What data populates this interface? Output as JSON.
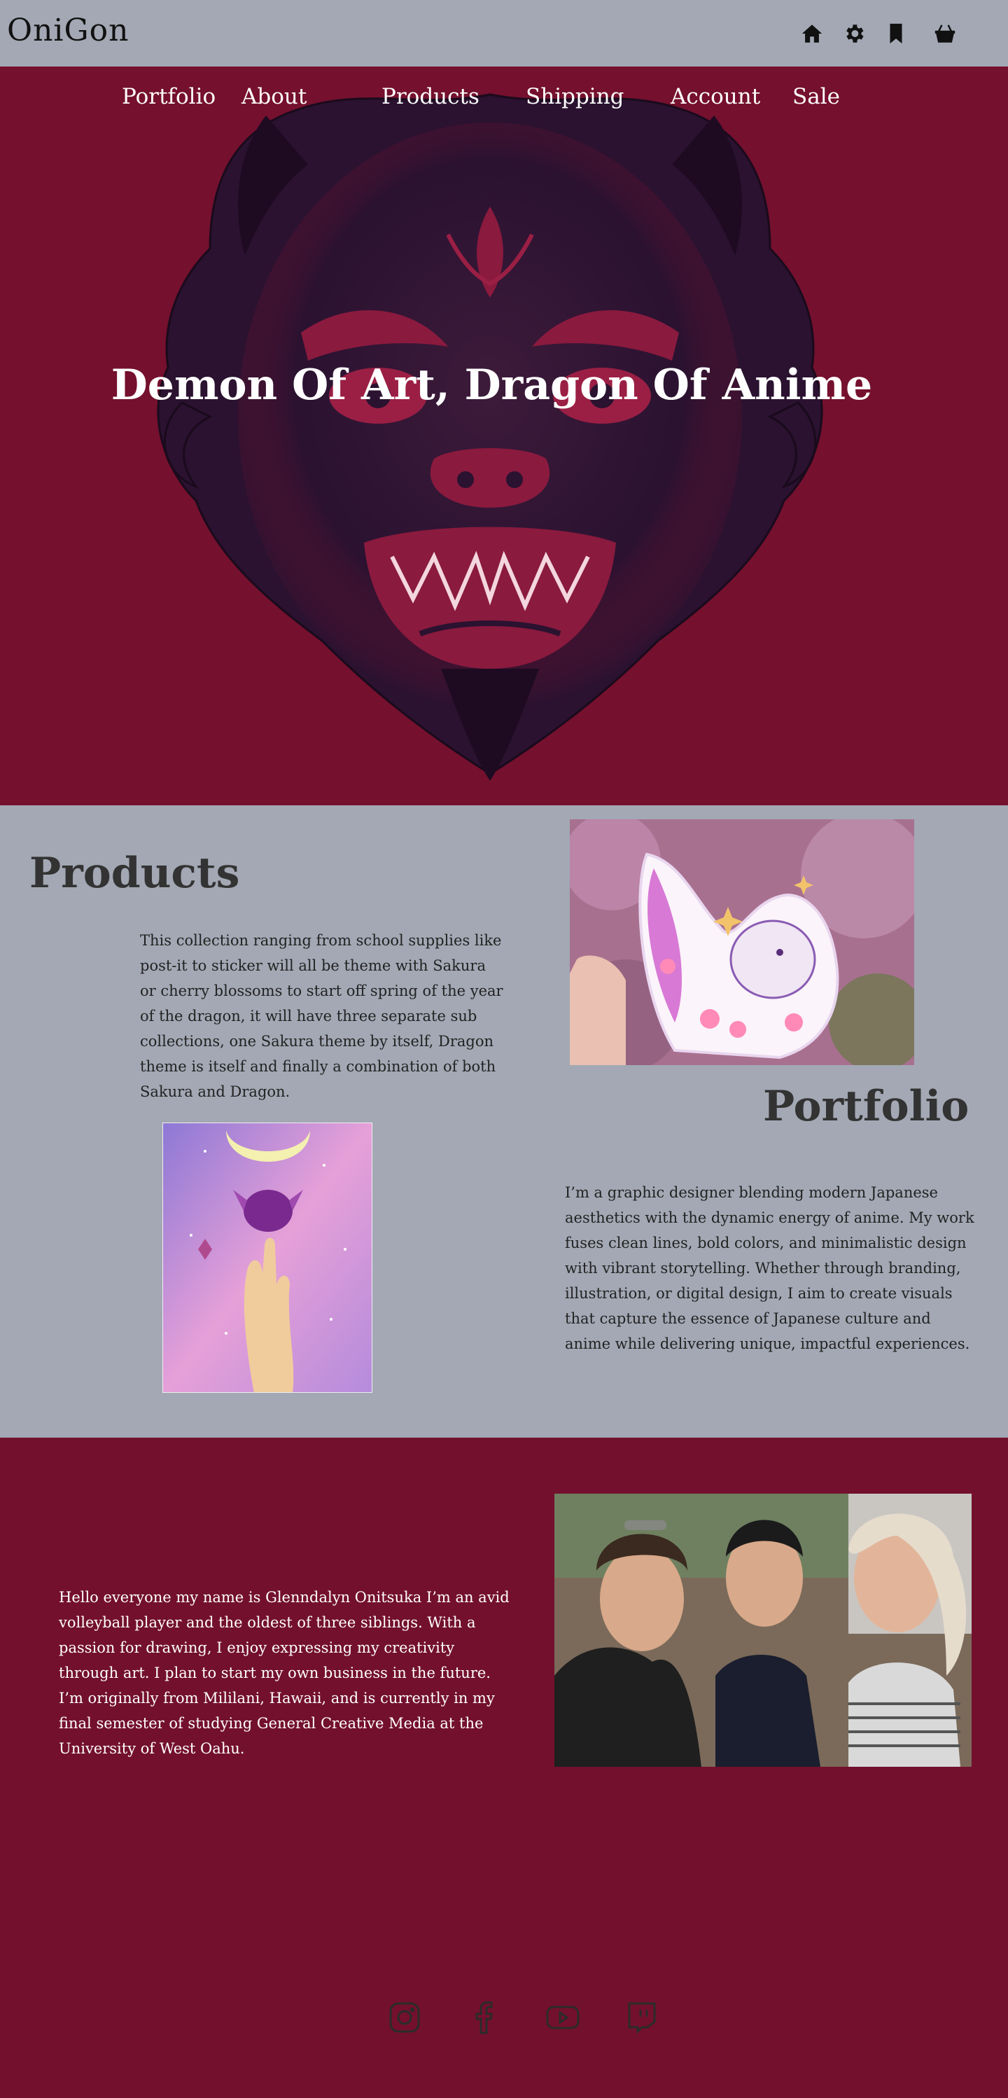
{
  "header": {
    "logo": "OniGon",
    "icons": [
      "home-icon",
      "gear-icon",
      "bookmark-icon",
      "basket-icon"
    ]
  },
  "nav": {
    "items": [
      "Portfolio",
      "About",
      "Products",
      "Shipping",
      "Account",
      "Sale"
    ]
  },
  "hero": {
    "title": "Demon Of Art, Dragon Of Anime"
  },
  "products": {
    "title": "Products",
    "text": "This collection ranging from school supplies like post-it to sticker will all be theme with Sakura or cherry blossoms to start off spring of the year of the dragon, it will have three separate sub collections, one Sakura theme by itself, Dragon theme is itself and finally a combination of both Sakura and Dragon."
  },
  "portfolio": {
    "title": "Portfolio",
    "text": "I’m a graphic designer blending modern Japanese aesthetics with the dynamic energy of anime. My work fuses clean lines, bold colors, and minimalistic design with vibrant storytelling. Whether through branding, illustration, or digital design, I aim to create visuals that capture the essence of Japanese culture and anime while delivering unique, impactful experiences."
  },
  "about": {
    "text": "Hello everyone my name is Glenndalyn Onitsuka I’m an avid volleyball player and the oldest of three siblings. With a passion for drawing, I enjoy expressing my creativity through art. I plan to start my own business in the future.  I’m originally from Mililani, Hawaii, and is currently in my final semester of studying General Creative Media at the University of West Oahu."
  },
  "social": {
    "icons": [
      "instagram-icon",
      "facebook-icon",
      "youtube-icon",
      "twitch-icon"
    ]
  },
  "colors": {
    "accent": "#75102e",
    "background": "#a3a8b4"
  }
}
